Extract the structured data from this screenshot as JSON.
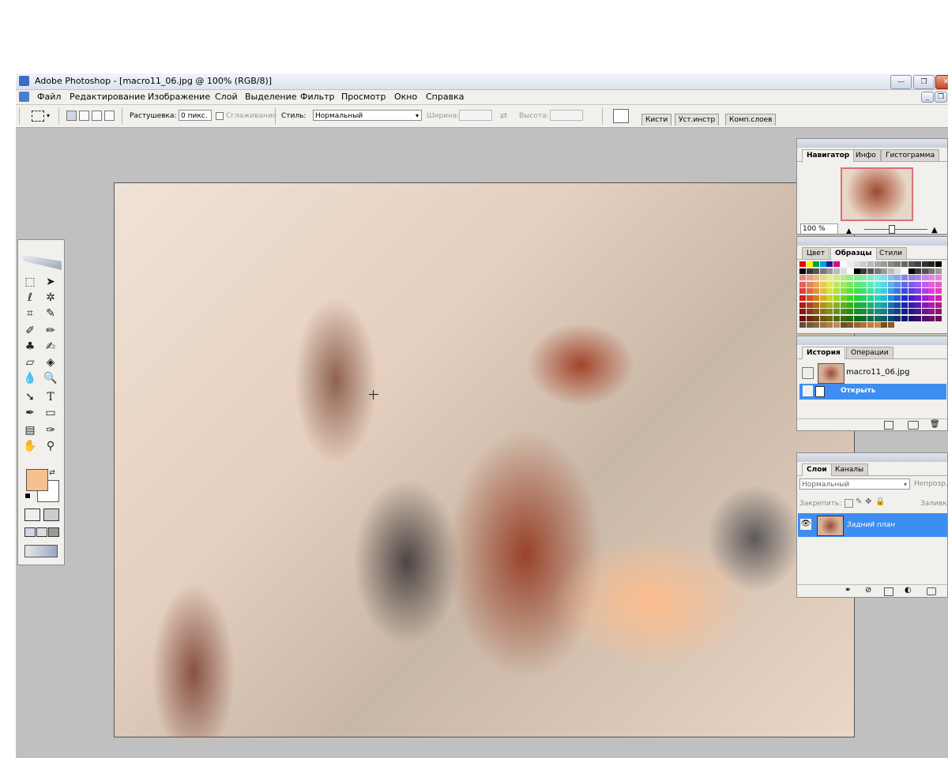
{
  "window": {
    "title": "Adobe Photoshop - [macro11_06.jpg @ 100% (RGB/8)]",
    "buttons": [
      "—",
      "❐",
      "✕"
    ]
  },
  "menu": {
    "items": [
      "Файл",
      "Редактирование",
      "Изображение",
      "Слой",
      "Выделение",
      "Фильтр",
      "Просмотр",
      "Окно",
      "Справка"
    ],
    "doc_buttons": [
      "_",
      "❐"
    ]
  },
  "options": {
    "feather_label": "Растушевка:",
    "feather_value": "0 пикс.",
    "antialias_label": "Сглаживание",
    "style_label": "Стиль:",
    "style_value": "Нормальный",
    "width_label": "Ширина:",
    "height_label": "Высота:",
    "well_tabs": [
      "Кисти",
      "Уст.инстр",
      "Комп.слоев"
    ]
  },
  "navigator": {
    "tabs": [
      "Навигатор",
      "Инфо",
      "Гистограмма"
    ],
    "zoom": "100 %"
  },
  "swatches": {
    "tabs": [
      "Цвет",
      "Образцы",
      "Стили"
    ]
  },
  "history": {
    "tabs": [
      "История",
      "Операции"
    ],
    "snapshot_name": "macro11_06.jpg",
    "step_name": "Открыть"
  },
  "layers": {
    "tabs": [
      "Слои",
      "Каналы"
    ],
    "blend_mode": "Нормальный",
    "opacity_label": "Непрозр.",
    "lock_label": "Закрепить:",
    "fill_label": "Заливка",
    "layer_name": "Задний план"
  },
  "colors": {
    "foreground": "#f5c18e",
    "background": "#ffffff",
    "selection": "#3d8ef0",
    "workspace": "#c0c0c0"
  }
}
